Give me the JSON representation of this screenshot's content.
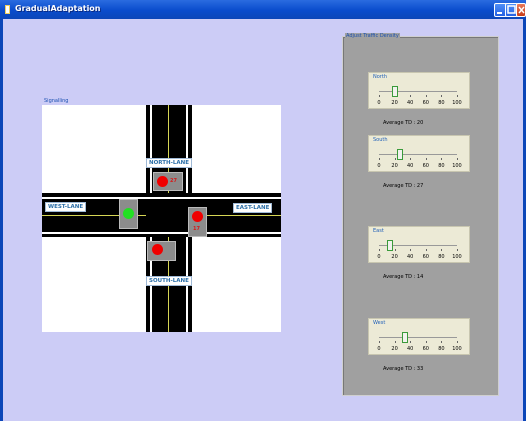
{
  "window": {
    "title": "GradualAdaptation",
    "controls": [
      "minimize-icon",
      "maximize-icon",
      "close-icon"
    ]
  },
  "signalling": {
    "label": "Signalling",
    "lanes": {
      "north": "NORTH-LANE",
      "south": "SOUTH-LANE",
      "west": "WEST-LANE",
      "east": "EAST-LANE"
    },
    "signals": [
      {
        "lane": "north",
        "state": "red",
        "count": "27"
      },
      {
        "lane": "east",
        "state": "red",
        "count": "17"
      },
      {
        "lane": "south",
        "state": "red",
        "count": ""
      },
      {
        "lane": "west",
        "state": "green",
        "count": ""
      }
    ]
  },
  "density_panel": {
    "label": "Adjust Traffic Density",
    "scale": [
      "0",
      "20",
      "40",
      "60",
      "80",
      "100"
    ],
    "sliders": [
      {
        "name": "North",
        "value": 20,
        "avg_text": "Average TD : 20"
      },
      {
        "name": "South",
        "value": 27,
        "avg_text": "Average TD : 27"
      },
      {
        "name": "East",
        "value": 14,
        "avg_text": "Average TD : 14"
      },
      {
        "name": "West",
        "value": 33,
        "avg_text": "Average TD : 33"
      }
    ]
  },
  "colors": {
    "background": "#ccccf6",
    "titlebar": "#0a4ccc",
    "signal_red": "#f00000",
    "signal_green": "#22e022"
  }
}
